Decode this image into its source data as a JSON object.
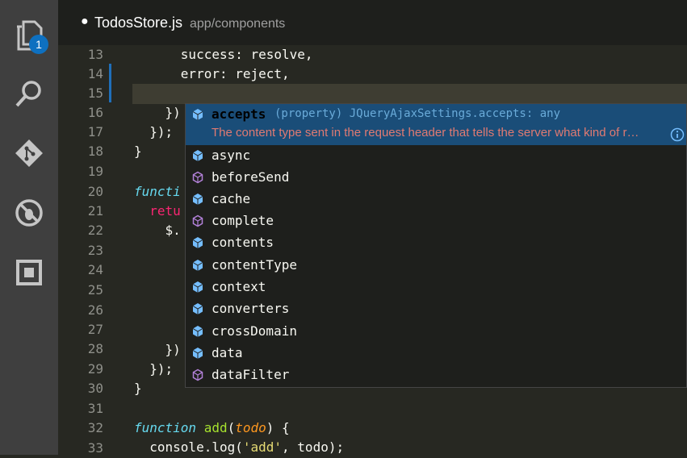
{
  "activity_bar": {
    "items": [
      {
        "name": "explorer-icon",
        "badge": "1"
      },
      {
        "name": "search-icon"
      },
      {
        "name": "git-icon"
      },
      {
        "name": "debug-icon"
      },
      {
        "name": "extensions-icon"
      }
    ]
  },
  "tab": {
    "modified_dot": "●",
    "filename": "TodosStore.js",
    "path": "app/components"
  },
  "line_numbers": [
    "13",
    "14",
    "15",
    "16",
    "17",
    "18",
    "19",
    "20",
    "21",
    "22",
    "23",
    "24",
    "25",
    "26",
    "27",
    "28",
    "29",
    "30",
    "31",
    "32",
    "33"
  ],
  "code_lines": {
    "l13": "      success: resolve,",
    "l14": "      error: reject,",
    "l16": "    })",
    "l17": "  });",
    "l18": "}",
    "l20": "functi",
    "l21": "  retu",
    "l22": "    $.",
    "l28": "    })",
    "l29": "  });",
    "l30": "}",
    "l32_kw": "function",
    "l32_fn": "add",
    "l32_p1": "(",
    "l32_prm": "todo",
    "l32_p2": ") {",
    "l33_a": "  console.log(",
    "l33_str": "'add'",
    "l33_b": ", todo);"
  },
  "suggest": {
    "selected": {
      "label": "accepts",
      "type_info": "(property) JQueryAjaxSettings.accepts: any",
      "doc": "The content type sent in the request header that tells the server what kind of r…"
    },
    "items": [
      {
        "label": "async",
        "kind": "property"
      },
      {
        "label": "beforeSend",
        "kind": "method"
      },
      {
        "label": "cache",
        "kind": "property"
      },
      {
        "label": "complete",
        "kind": "method"
      },
      {
        "label": "contents",
        "kind": "property"
      },
      {
        "label": "contentType",
        "kind": "property"
      },
      {
        "label": "context",
        "kind": "property"
      },
      {
        "label": "converters",
        "kind": "property"
      },
      {
        "label": "crossDomain",
        "kind": "property"
      },
      {
        "label": "data",
        "kind": "property"
      },
      {
        "label": "dataFilter",
        "kind": "method"
      }
    ]
  },
  "colors": {
    "editor_bg": "#272822",
    "selection": "#1a4d78",
    "keyword": "#66d9ef",
    "function": "#a6e22e",
    "param": "#fd971f",
    "string": "#e6db74"
  }
}
